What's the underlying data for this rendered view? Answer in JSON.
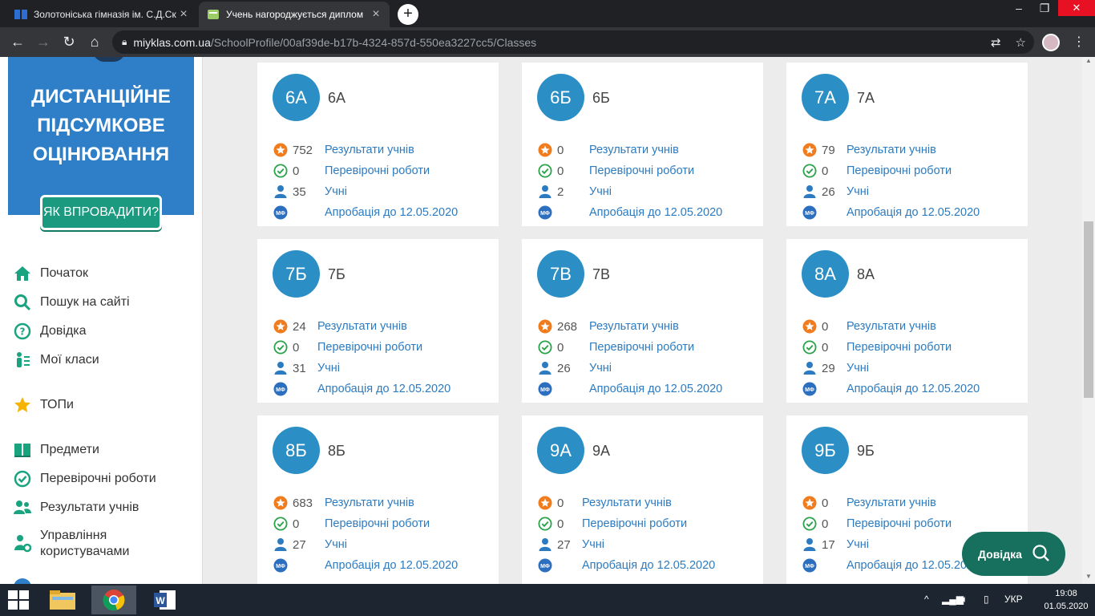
{
  "browser": {
    "tabs": [
      {
        "title": "Золотоніська гімназія ім. С.Д.Ск",
        "active": false
      },
      {
        "title": "Учень нагороджується диплом",
        "active": true
      }
    ],
    "url_host": "miyklas.com.ua",
    "url_path": "/SchoolProfile/00af39de-b17b-4324-857d-550ea3227cc5/Classes"
  },
  "sidebar": {
    "banner_heading": "ДИСТАНЦІЙНЕ ПІДСУМКОВЕ ОЦІНЮВАННЯ",
    "banner_button": "ЯК ВПРОВАДИТИ?",
    "menu": [
      {
        "label": "Початок",
        "icon": "home-icon"
      },
      {
        "label": "Пошук на сайті",
        "icon": "search-icon"
      },
      {
        "label": "Довідка",
        "icon": "help-circle-icon"
      },
      {
        "label": "Мої класи",
        "icon": "classes-icon"
      },
      {
        "label": "ТОПи",
        "icon": "star-icon"
      },
      {
        "label": "Предмети",
        "icon": "book-icon"
      },
      {
        "label": "Перевірочні роботи",
        "icon": "check-circle-icon"
      },
      {
        "label": "Результати учнів",
        "icon": "users-icon"
      },
      {
        "label": "Управління користувачами",
        "icon": "user-gear-icon"
      }
    ]
  },
  "link_labels": {
    "results": "Результати учнів",
    "tests": "Перевірочні роботи",
    "students": "Учні",
    "approbation": "Апробація до 12.05.2020"
  },
  "classes": [
    {
      "badge": "6А",
      "name": "6А",
      "results": "752",
      "tests": "0",
      "students": "35"
    },
    {
      "badge": "6Б",
      "name": "6Б",
      "results": "0",
      "tests": "0",
      "students": "2"
    },
    {
      "badge": "7А",
      "name": "7А",
      "results": "79",
      "tests": "0",
      "students": "26"
    },
    {
      "badge": "7Б",
      "name": "7Б",
      "results": "24",
      "tests": "0",
      "students": "31"
    },
    {
      "badge": "7В",
      "name": "7В",
      "results": "268",
      "tests": "0",
      "students": "26"
    },
    {
      "badge": "8А",
      "name": "8А",
      "results": "0",
      "tests": "0",
      "students": "29"
    },
    {
      "badge": "8Б",
      "name": "8Б",
      "results": "683",
      "tests": "0",
      "students": "27"
    },
    {
      "badge": "9А",
      "name": "9А",
      "results": "0",
      "tests": "0",
      "students": "27"
    },
    {
      "badge": "9Б",
      "name": "9Б",
      "results": "0",
      "tests": "0",
      "students": "17"
    }
  ],
  "help_button": "Довідка",
  "taskbar": {
    "language": "УКР",
    "time": "19:08",
    "date": "01.05.2020"
  },
  "colors": {
    "badge": "#2b8fc6",
    "link": "#2c7bc0",
    "banner": "#2e7fc7",
    "help_button": "#17705d"
  }
}
